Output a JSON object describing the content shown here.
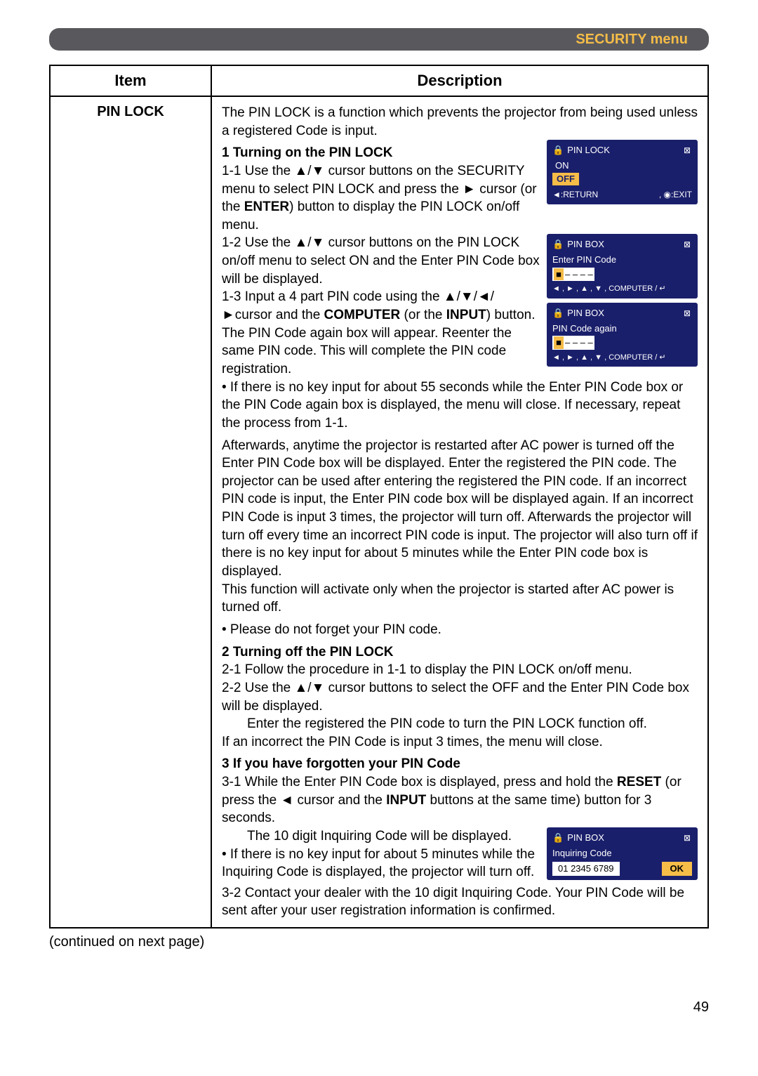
{
  "header": {
    "breadcrumb": "SECURITY menu"
  },
  "table": {
    "head_item": "Item",
    "head_desc": "Description",
    "item_label": "PIN LOCK"
  },
  "desc": {
    "intro": "The PIN LOCK is a function which prevents the projector from being used unless a registered Code is input.",
    "sec1_head": "1 Turning on the PIN LOCK",
    "p11a": "1-1 Use the ▲/▼ cursor buttons on the SECURITY menu to select PIN LOCK and press the ► cursor (or the ",
    "p11b_enter": "ENTER",
    "p11c": ") button to display the PIN LOCK on/off menu.",
    "p12": "1-2 Use the ▲/▼ cursor buttons on the PIN LOCK on/off menu to select ON and the Enter PIN Code box will be displayed.",
    "p13a": "1-3 Input a 4 part PIN code using the ▲/▼/◄/►cursor and the ",
    "p13b_comp": "COMPUTER",
    "p13c": " (or the ",
    "p13d_input": "INPUT",
    "p13e": ") button.",
    "p13f": "The PIN Code again box will appear. Reenter the same PIN code. This will complete the PIN code registration.",
    "bullet_nokey": "• If there is no key input for about 55 seconds while the Enter PIN Code box or the PIN Code again box is displayed, the menu will close. If necessary, repeat the process from 1-1.",
    "after_para": "Afterwards, anytime the projector is restarted after AC power  is turned off the Enter PIN Code box will be displayed. Enter the registered the PIN code. The projector can be used after entering the registered the PIN code. If an incorrect PIN code is input, the Enter PIN code box will be displayed again. If an incorrect PIN Code is input 3 times, the projector will turn off. Afterwards the projector will turn off every time an incorrect PIN code is input. The projector will also turn off if there is no key input for about 5 minutes while the Enter PIN code box is displayed.",
    "ac_note": "This function will activate only when the projector is started after AC power is turned off.",
    "forget_note": "• Please do not forget your PIN code.",
    "sec2_head": "2 Turning off the PIN LOCK",
    "p21": "2-1 Follow the procedure in 1-1 to display the PIN LOCK on/off menu.",
    "p22": "2-2  Use the ▲/▼ cursor buttons to select the OFF and the Enter PIN Code box will be displayed.",
    "p22b": "Enter the registered the PIN code to turn the PIN LOCK function off.",
    "p22c": "If an incorrect the PIN Code is input 3 times, the menu will close.",
    "sec3_head": "3 If you have forgotten your PIN Code",
    "p31a": "3-1 While the Enter PIN Code box is displayed, press and hold the ",
    "p31b_reset": "RESET",
    "p31c": " (or press the ◄ cursor and the ",
    "p31d_input": "INPUT",
    "p31e": " buttons at the same time) button for 3 seconds.",
    "p31f": "The 10 digit Inquiring Code will be displayed.",
    "p31g": "• If there is no key input for about 5 minutes while the Inquiring Code is displayed, the projector will turn off.",
    "p32": "3-2 Contact your dealer with the 10 digit Inquiring Code. Your PIN Code will be sent after your user registration information is confirmed."
  },
  "osd1": {
    "title": "PIN LOCK",
    "on": "ON",
    "off": "OFF",
    "return": "◄:RETURN",
    "exit": ", ◉:EXIT"
  },
  "osd2": {
    "title": "PIN BOX",
    "sub": "Enter PIN Code",
    "pins": "– – – –",
    "ctrl": "◄ , ► , ▲ , ▼ , COMPUTER / ↵"
  },
  "osd3": {
    "title": "PIN BOX",
    "sub": "PIN Code again",
    "pins": "– – – –",
    "ctrl": "◄ , ► , ▲ , ▼ , COMPUTER / ↵"
  },
  "osd4": {
    "title": "PIN BOX",
    "sub": "Inquiring Code",
    "code": "01 2345 6789",
    "ok": "OK"
  },
  "footer": {
    "continued": "(continued on next page)",
    "page": "49"
  }
}
